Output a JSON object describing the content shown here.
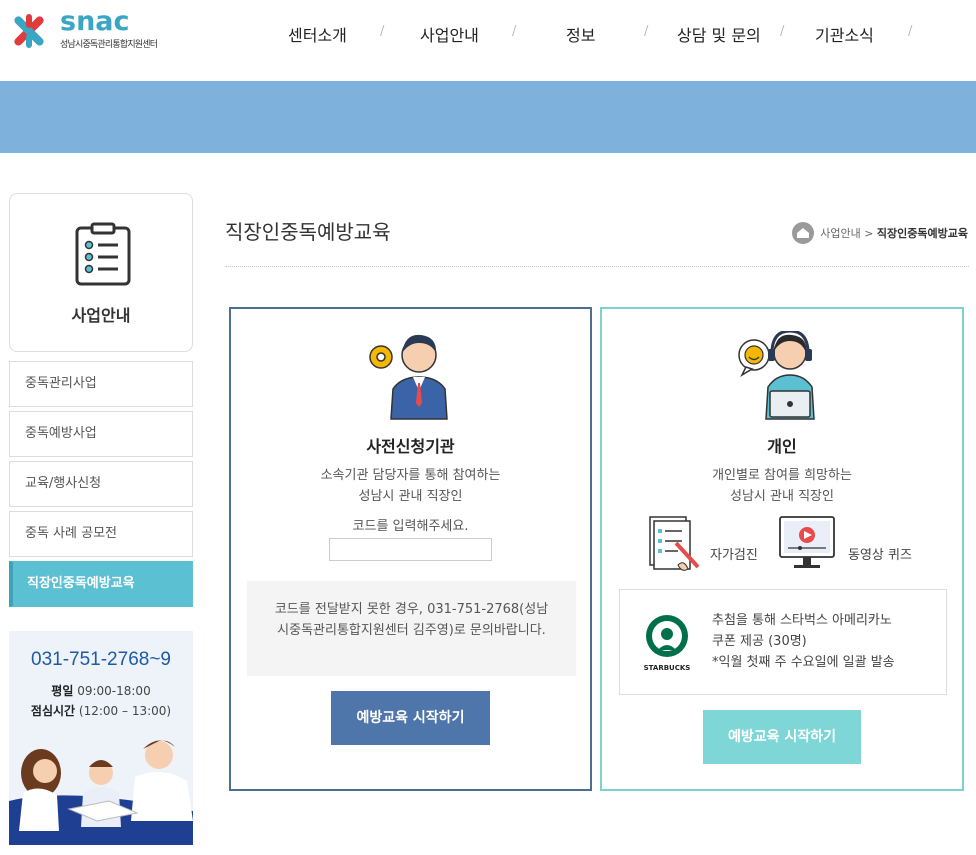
{
  "brand": {
    "name": "snac",
    "subtitle": "성남시중독관리통합지원센터"
  },
  "nav": {
    "items": [
      "센터소개",
      "사업안내",
      "정보",
      "상담 및 문의",
      "기관소식"
    ],
    "separator": "/"
  },
  "sidebar": {
    "section_title": "사업안내",
    "section_icon": "clipboard-checklist-icon",
    "items": [
      {
        "label": "중독관리사업",
        "active": false
      },
      {
        "label": "중독예방사업",
        "active": false
      },
      {
        "label": "교육/행사신청",
        "active": false
      },
      {
        "label": "중독 사례 공모전",
        "active": false
      },
      {
        "label": "직장인중독예방교육",
        "active": true
      }
    ],
    "contact": {
      "phone": "031-751-2768~9",
      "weekday_label": "평일",
      "weekday_hours": "09:00-18:00",
      "lunch_label": "점심시간",
      "lunch_hours": "(12:00 – 13:00)"
    }
  },
  "page": {
    "title": "직장인중독예방교육",
    "breadcrumb": {
      "parent": "사업안내",
      "separator": ">",
      "current": "직장인중독예방교육"
    }
  },
  "cards": {
    "institution": {
      "title": "사전신청기관",
      "desc_line1": "소속기관 담당자를 통해 참여하는",
      "desc_line2": "성남시 관내 직장인",
      "code_label": "코드를 입력해주세요.",
      "code_value": "",
      "notice": "코드를 전달받지 못한 경우, 031-751-2768(성남시중독관리통합지원센터 김주영)로 문의바랍니다.",
      "button": "예방교육 시작하기"
    },
    "individual": {
      "title": "개인",
      "desc_line1": "개인별로 참여를 희망하는",
      "desc_line2": "성남시 관내 직장인",
      "feature1": "자가검진",
      "feature2": "동영상 퀴즈",
      "reward_line1": "추첨을 통해 스타벅스 아메리카노",
      "reward_line2": "쿠폰 제공 (30명)",
      "reward_line3": "*익월 첫째 주 수요일에 일괄 발송",
      "reward_logo_text": "STARBUCKS",
      "button": "예방교육 시작하기"
    }
  },
  "colors": {
    "banner": "#7eb1dc",
    "active_menu": "#5cc0d3",
    "left_card_border": "#4c6f91",
    "right_card_border": "#7fd1d1",
    "left_button": "#4f76aa",
    "right_button": "#7fd6d6",
    "phone": "#1e5aa8"
  }
}
